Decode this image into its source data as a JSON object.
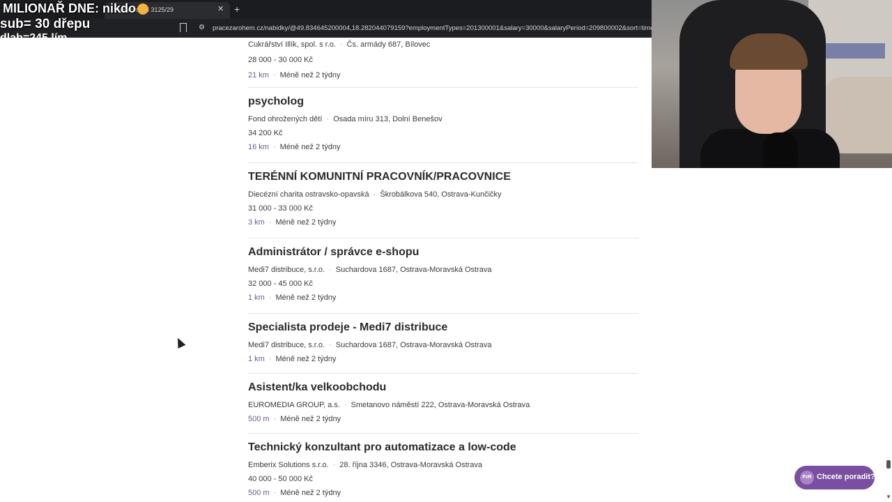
{
  "browser": {
    "tab_title": "prácodolní 3125/29",
    "url": "pracezarohem.cz/nabidky/@49.834645200004,18.282044079159?employmentTypes=201300001&salary=30000&salaryPeriod=209800002&sort=time&p"
  },
  "overlay": {
    "title": "MILIONAŘ DNE: nikdo",
    "sub": "sub= 30 dřepu",
    "clipped": "dlab=245 lím"
  },
  "listings": [
    {
      "company": "Cukrářství Illík, spol. s r.o.",
      "address": "Čs. armády 687, Bílovec",
      "salary": "28 000 - 30 000 Kč",
      "distance": "21 km",
      "age": "Méně než 2 týdny"
    },
    {
      "title": "psycholog",
      "company": "Fond ohrožených dětí",
      "address": "Osada míru 313, Dolní Benešov",
      "salary": "34 200 Kč",
      "distance": "16 km",
      "age": "Méně než 2 týdny"
    },
    {
      "title": "TERÉNNÍ KOMUNITNÍ PRACOVNÍK/PRACOVNICE",
      "company": "Diecézní charita ostravsko-opavská",
      "address": "Škrobálkova 540, Ostrava-Kunčičky",
      "salary": "31 000 - 33 000 Kč",
      "distance": "3 km",
      "age": "Méně než 2 týdny"
    },
    {
      "title": "Administrátor / správce e-shopu",
      "company": "Medi7 distribuce, s.r.o.",
      "address": "Suchardova 1687, Ostrava-Moravská Ostrava",
      "salary": "32 000 - 45 000 Kč",
      "distance": "1 km",
      "age": "Méně než 2 týdny"
    },
    {
      "title": "Specialista prodeje - Medi7 distribuce",
      "company": "Medi7 distribuce, s.r.o.",
      "address": "Suchardova 1687, Ostrava-Moravská Ostrava",
      "distance": "1 km",
      "age": "Méně než 2 týdny"
    },
    {
      "title": "Asistent/ka velkoobchodu",
      "company": "EUROMEDIA GROUP, a.s.",
      "address": "Smetanovo náměstí 222, Ostrava-Moravská Ostrava",
      "distance": "500 m",
      "age": "Méně než 2 týdny"
    },
    {
      "title": "Technický konzultant pro automatizace a low-code",
      "company": "Emberix Solutions s.r.o.",
      "address": "28. října 3346, Ostrava-Moravská Ostrava",
      "salary": "40 000 - 50 000 Kč",
      "distance": "500 m",
      "age": "Méně než 2 týdny"
    }
  ],
  "chat": {
    "label": "Chcete poradit?",
    "logo": "PzR"
  },
  "icons": {
    "bookmark": "bookmark-icon",
    "site_info": "tune-icon",
    "close": "close-icon",
    "new_tab": "plus-icon"
  }
}
